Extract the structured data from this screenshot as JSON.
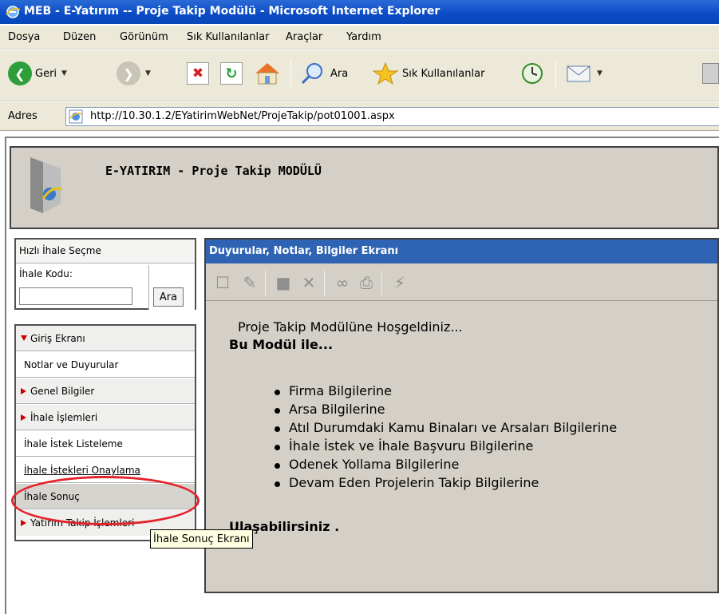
{
  "window": {
    "title": "MEB - E-Yatırım -- Proje Takip Modülü - Microsoft Internet Explorer"
  },
  "menu": [
    "Dosya",
    "Düzen",
    "Görünüm",
    "Sık Kullanılanlar",
    "Araçlar",
    "Yardım"
  ],
  "toolbar": {
    "back_label": "Geri",
    "search_label": "Ara",
    "favorites_label": "Sık Kullanılanlar"
  },
  "address": {
    "label": "Adres",
    "url": "http://10.30.1.2/EYatirimWebNet/ProjeTakip/pot01001.aspx"
  },
  "app": {
    "title": "E-YATIRIM - Proje Takip MODÜLÜ"
  },
  "quick_select": {
    "title": "Hızlı İhale Seçme",
    "code_label": "İhale Kodu:",
    "code_value": "",
    "search_button": "Ara"
  },
  "nav": {
    "items": [
      {
        "label": "Giriş Ekranı",
        "type": "head-open"
      },
      {
        "label": "Notlar ve Duyurular",
        "type": "sub"
      },
      {
        "label": "Genel Bilgiler",
        "type": "head"
      },
      {
        "label": "İhale İşlemleri",
        "type": "head"
      },
      {
        "label": "İhale İstek Listeleme",
        "type": "sub"
      },
      {
        "label": "İhale İstekleri Onaylama",
        "type": "sub"
      },
      {
        "label": "İhale Sonuç",
        "type": "sub-selected"
      },
      {
        "label": "Yatırım Takip İşlemleri",
        "type": "head"
      }
    ]
  },
  "tooltip": "İhale Sonuç Ekranı",
  "panel": {
    "title": "Duyurular, Notlar, Bilgiler Ekranı",
    "welcome": "Proje Takip Modülüne Hoşgeldiniz...",
    "with_module": "Bu Modül ile...",
    "list": [
      "Firma Bilgilerine",
      "Arsa Bilgilerine",
      "Atıl Durumdaki Kamu Binaları ve Arsaları Bilgilerine",
      "İhale İstek ve İhale Başvuru Bilgilerine",
      "Odenek Yollama Bilgilerine",
      "Devam Eden Projelerin Takip Bilgilerine"
    ],
    "reach": "Ulaşabilirsiniz ."
  },
  "colors": {
    "titlebar": "#0a4bc5",
    "panel_header": "#2e64b3",
    "annotation": "#e4232a",
    "tooltip_bg": "#ffffe1"
  }
}
